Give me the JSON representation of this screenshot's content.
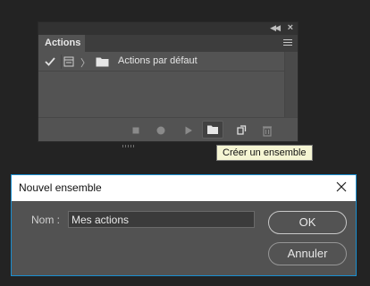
{
  "panel": {
    "tab_label": "Actions",
    "rows": [
      {
        "label": "Actions par défaut",
        "checked": true
      }
    ]
  },
  "bottom_toolbar": {
    "buttons": [
      "stop-icon",
      "record-icon",
      "play-icon",
      "new-set-folder-icon",
      "new-action-icon",
      "delete-icon"
    ]
  },
  "tooltip": {
    "text": "Créer un ensemble"
  },
  "dialog": {
    "title": "Nouvel ensemble",
    "name_label": "Nom :",
    "name_value": "Mes actions",
    "ok_label": "OK",
    "cancel_label": "Annuler"
  },
  "colors": {
    "background": "#232323",
    "panel": "#535353",
    "dialog_border": "#1a8fd0",
    "tooltip_bg": "#f5f5d3"
  }
}
